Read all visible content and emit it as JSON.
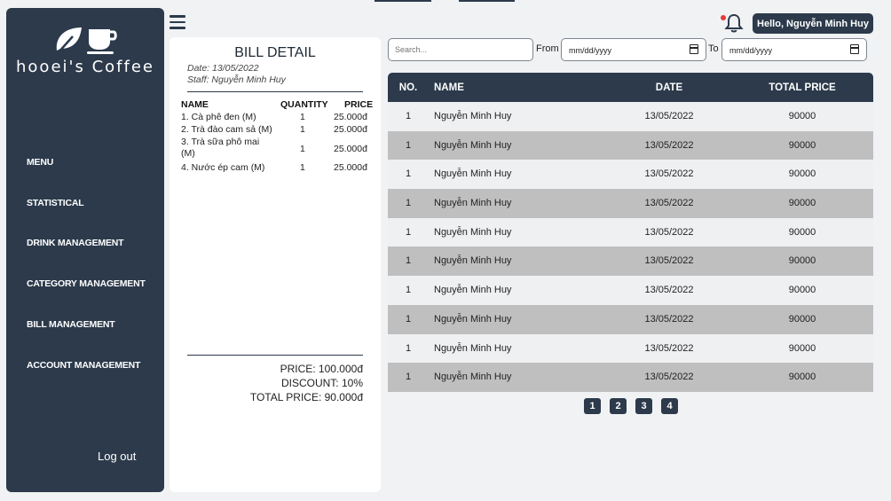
{
  "app": {
    "brand": "hooei's Coffee"
  },
  "sidebar": {
    "items": [
      {
        "label": "MENU"
      },
      {
        "label": "STATISTICAL"
      },
      {
        "label": "DRINK MANAGEMENT"
      },
      {
        "label": "CATEGORY MANAGEMENT"
      },
      {
        "label": "BILL MANAGEMENT"
      },
      {
        "label": "ACCOUNT MANAGEMENT"
      }
    ],
    "logout": "Log out"
  },
  "header": {
    "greeting": "Hello, Nguyễn Minh Huy",
    "has_notification": true
  },
  "bill": {
    "title": "BILL DETAIL",
    "date": "Date: 13/05/2022",
    "staff": "Staff: Nguyễn Minh Huy",
    "columns": {
      "name": "NAME",
      "quantity": "QUANTITY",
      "price": "PRICE"
    },
    "items": [
      {
        "name": "1. Cà phê đen (M)",
        "quantity": "1",
        "price": "25.000đ"
      },
      {
        "name": "2. Trà đào cam sả (M)",
        "quantity": "1",
        "price": "25.000đ"
      },
      {
        "name": "3. Trà sữa phô mai (M)",
        "quantity": "1",
        "price": "25.000đ"
      },
      {
        "name": "4. Nước ép cam (M)",
        "quantity": "1",
        "price": "25.000đ"
      }
    ],
    "price": "PRICE: 100.000đ",
    "discount": "DISCOUNT: 10%",
    "total": "TOTAL PRICE: 90.000đ"
  },
  "filters": {
    "search_placeholder": "Search...",
    "from_label": "From",
    "to_label": "To",
    "from_value": "mm/dd/yyyy",
    "to_value": "mm/dd/yyyy"
  },
  "table": {
    "columns": {
      "no": "NO.",
      "name": "NAME",
      "date": "DATE",
      "total": "TOTAL PRICE"
    },
    "rows": [
      {
        "no": "1",
        "name": "Nguyễn Minh Huy",
        "date": "13/05/2022",
        "total": "90000"
      },
      {
        "no": "1",
        "name": "Nguyễn Minh Huy",
        "date": "13/05/2022",
        "total": "90000"
      },
      {
        "no": "1",
        "name": "Nguyễn Minh Huy",
        "date": "13/05/2022",
        "total": "90000"
      },
      {
        "no": "1",
        "name": "Nguyễn Minh Huy",
        "date": "13/05/2022",
        "total": "90000"
      },
      {
        "no": "1",
        "name": "Nguyễn Minh Huy",
        "date": "13/05/2022",
        "total": "90000"
      },
      {
        "no": "1",
        "name": "Nguyễn Minh Huy",
        "date": "13/05/2022",
        "total": "90000"
      },
      {
        "no": "1",
        "name": "Nguyễn Minh Huy",
        "date": "13/05/2022",
        "total": "90000"
      },
      {
        "no": "1",
        "name": "Nguyễn Minh Huy",
        "date": "13/05/2022",
        "total": "90000"
      },
      {
        "no": "1",
        "name": "Nguyễn Minh Huy",
        "date": "13/05/2022",
        "total": "90000"
      },
      {
        "no": "1",
        "name": "Nguyễn Minh Huy",
        "date": "13/05/2022",
        "total": "90000"
      }
    ]
  },
  "pagination": {
    "pages": [
      "1",
      "2",
      "3",
      "4"
    ]
  },
  "colors": {
    "primary": "#2c3a4b",
    "row_alt": "#bfbfbf",
    "notification_dot": "#e53935"
  }
}
